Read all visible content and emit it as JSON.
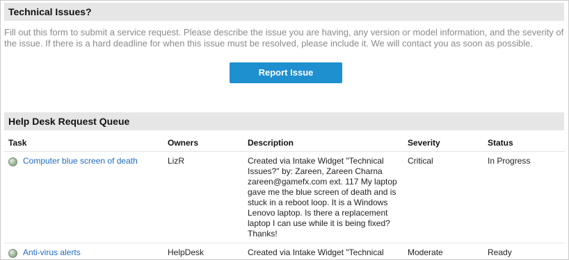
{
  "technical_issues": {
    "title": "Technical Issues?",
    "intro": "Fill out this form to submit a service request. Please describe the issue you are having, any version or model information, and the severity of the issue. If there is a hard deadline for when this issue must be resolved, please include it. We will contact you as soon as possible.",
    "report_button": "Report Issue",
    "accent_color": "#1e8fcf"
  },
  "queue": {
    "title": "Help Desk Request Queue",
    "columns": [
      "Task",
      "Owners",
      "Description",
      "Severity",
      "Status"
    ],
    "rows": [
      {
        "status_icon": "status-circle-icon",
        "task": "Computer blue screen of death",
        "owners": "LizR",
        "description": "Created via Intake Widget \"Technical Issues?\" by: Zareen, Zareen Charna zareen@gamefx.com ext. 117 My laptop gave me the blue screen of death and is stuck in a reboot loop. It is a Windows Lenovo laptop. Is there a replacement laptop I can use while it is being fixed? Thanks!",
        "severity": "Critical",
        "status": "In Progress"
      },
      {
        "status_icon": "status-circle-icon",
        "task": "Anti-virus alerts",
        "owners": "HelpDesk",
        "description": "Created via Intake Widget \"Technical Issues?\" by: Nick, Nick Smith",
        "severity": "Moderate",
        "status": "Ready"
      }
    ]
  }
}
